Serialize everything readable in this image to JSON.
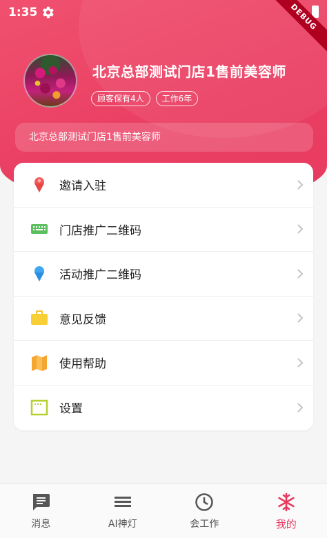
{
  "status": {
    "time": "1:35",
    "debug": "DEBUG"
  },
  "profile": {
    "name": "北京总部测试门店1售前美容师",
    "tags": [
      "顾客保有4人",
      "工作6年"
    ],
    "store": "北京总部测试门店1售前美容师"
  },
  "menu": [
    {
      "label": "邀请入驻",
      "icon": "red-cone-icon"
    },
    {
      "label": "门店推广二维码",
      "icon": "green-keyboard-icon"
    },
    {
      "label": "活动推广二维码",
      "icon": "blue-cone-icon"
    },
    {
      "label": "意见反馈",
      "icon": "yellow-briefcase-icon"
    },
    {
      "label": "使用帮助",
      "icon": "orange-map-icon"
    },
    {
      "label": "设置",
      "icon": "green-frame-icon"
    }
  ],
  "tabs": [
    {
      "label": "消息",
      "icon": "message-icon"
    },
    {
      "label": "AI神灯",
      "icon": "menu-lines-icon"
    },
    {
      "label": "会工作",
      "icon": "clock-icon"
    },
    {
      "label": "我的",
      "icon": "snowflake-icon",
      "active": true
    }
  ],
  "colors": {
    "accent": "#e83a5f",
    "header": "#ea3f63"
  }
}
